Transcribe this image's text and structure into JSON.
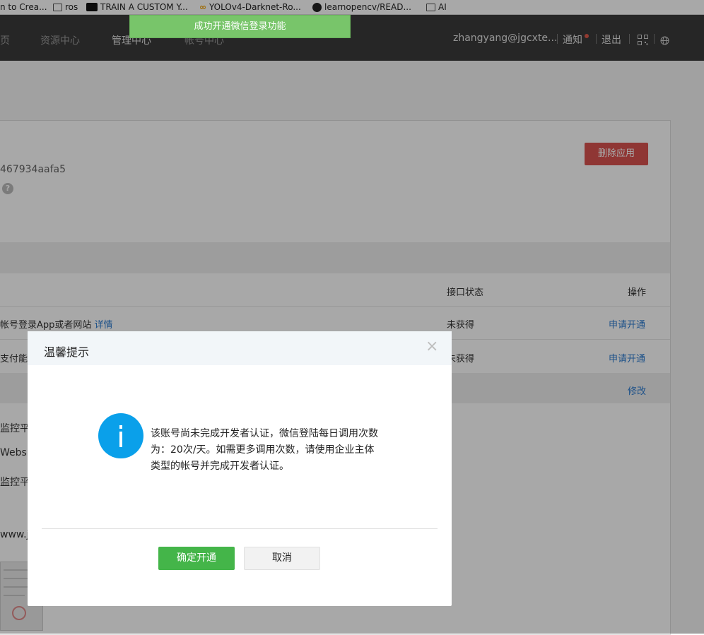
{
  "bookmarks": [
    {
      "label": "n to Crea...",
      "icon": "none"
    },
    {
      "label": "ros",
      "icon": "folder-icon"
    },
    {
      "label": "TRAIN A CUSTOM Y...",
      "icon": "roboflow-icon"
    },
    {
      "label": "YOLOv4-Darknet-Ro...",
      "icon": "colab-icon"
    },
    {
      "label": "learnopencv/READ...",
      "icon": "github-icon"
    },
    {
      "label": "AI",
      "icon": "folder-icon"
    }
  ],
  "nav": {
    "items": [
      "页",
      "资源中心",
      "管理中心",
      "帐号中心"
    ],
    "user": "zhangyang@jgcxte...",
    "notify": "通知",
    "logout": "退出"
  },
  "toast": "成功开通微信登录功能",
  "app": {
    "appid_partial": "467934aafa5",
    "help": "?",
    "delete_label": "删除应用"
  },
  "table": {
    "headers": {
      "status": "接口状态",
      "action": "操作"
    },
    "rows": [
      {
        "name": "帐号登录App或者网站",
        "detail": "详情",
        "status": "未获得",
        "action": "申请开通"
      },
      {
        "name": "支付能",
        "status": "未获得",
        "action": "申请开通"
      }
    ],
    "edit_label": "修改"
  },
  "left_texts": [
    "监控平台",
    "Websi",
    "监控平台",
    "www.j"
  ],
  "modal": {
    "title": "温馨提示",
    "close": "×",
    "message_line1": "该账号尚未完成开发者认证，微信登陆每日调用次数",
    "message_line2": "为：20次/天。如需更多调用次数，请使用企业主体",
    "message_line3": "类型的帐号并完成开发者认证。",
    "confirm": "确定开通",
    "cancel": "取消"
  },
  "colors": {
    "nav_bg": "#3b3b3b",
    "toast_bg": "#78c56a",
    "danger": "#d9534f",
    "primary_green": "#44b549",
    "info_blue": "#0aa0ea",
    "link": "#2d7cd1"
  }
}
